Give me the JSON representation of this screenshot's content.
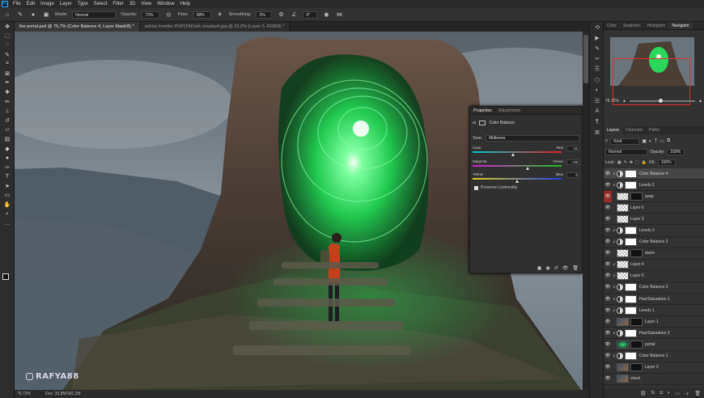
{
  "menu": [
    "File",
    "Edit",
    "Image",
    "Layer",
    "Type",
    "Select",
    "Filter",
    "3D",
    "View",
    "Window",
    "Help"
  ],
  "options": {
    "mode_label": "Mode:",
    "mode_value": "Normal",
    "opacity_label": "Opacity:",
    "opacity_value": "72%",
    "flow_label": "Flow:",
    "flow_value": "38%",
    "smoothing_label": "Smoothing:",
    "smoothing_value": "2%",
    "angle_value": "0°"
  },
  "tabs": [
    "the portal.psd @ 76,7% (Color Balance 4, Layer Mask/8) *",
    "ashley knedler PiSPjTADokk unsplash.jpg @ 22,2% (Layer 0, RGB/8) *"
  ],
  "status": {
    "zoom": "76,72%",
    "doc": "Doc: 15,8M/181,2M"
  },
  "watermark": "RAFYA88",
  "panel": {
    "tabs": [
      "Color",
      "Swatches",
      "Histogram",
      "Navigator"
    ],
    "zoom_value": "76,72%",
    "layers_tabs": [
      "Layers",
      "Channels",
      "Paths"
    ],
    "filter_value": "Kind",
    "blend_value": "Normal",
    "opacity_label": "Opacity:",
    "opacity_value": "100%",
    "lock_label": "Lock:",
    "fill_label": "Fill:",
    "fill_value": "100%"
  },
  "layers": [
    {
      "name": "Color Balance 4",
      "type": "adj",
      "sel": true,
      "clip": true
    },
    {
      "name": "Levels 2",
      "type": "adj",
      "clip": true
    },
    {
      "name": "asap",
      "type": "check",
      "mask": "dark",
      "eye_red": true
    },
    {
      "name": "Layer 6",
      "type": "check"
    },
    {
      "name": "Layer 3",
      "type": "check"
    },
    {
      "name": "Levels 3",
      "type": "adj",
      "clip": true
    },
    {
      "name": "Color Balance 2",
      "type": "adj",
      "clip": true
    },
    {
      "name": "stairs",
      "type": "check",
      "mask": "dark"
    },
    {
      "name": "Layer 4",
      "type": "check",
      "clip": true
    },
    {
      "name": "Layer 5",
      "type": "check",
      "clip": true
    },
    {
      "name": "Color Balance 3",
      "type": "adj",
      "clip": true
    },
    {
      "name": "Hue/Saturation 1",
      "type": "adj",
      "clip": true
    },
    {
      "name": "Levels 1",
      "type": "adj",
      "clip": true
    },
    {
      "name": "Layer 1",
      "type": "img",
      "mask": "dark"
    },
    {
      "name": "Hue/Saturation 2",
      "type": "adj",
      "clip": true
    },
    {
      "name": "portal",
      "type": "green",
      "mask": "dark"
    },
    {
      "name": "Color Balance 1",
      "type": "adj",
      "clip": true
    },
    {
      "name": "Layer 2",
      "type": "img",
      "mask": "dark"
    },
    {
      "name": "cloud",
      "type": "img"
    }
  ],
  "properties": {
    "tabs": [
      "Properties",
      "Adjustments"
    ],
    "title": "Color Balance",
    "tone_label": "Tone:",
    "tone_value": "Midtones",
    "sliders": [
      {
        "left": "Cyan",
        "right": "Red",
        "value": "-11",
        "pos": 0.45,
        "c1": "#00c8d0",
        "c2": "#e02020"
      },
      {
        "left": "Magenta",
        "right": "Green",
        "value": "+26",
        "pos": 0.62,
        "c1": "#d020d0",
        "c2": "#20c020"
      },
      {
        "left": "Yellow",
        "right": "Blue",
        "value": "0",
        "pos": 0.5,
        "c1": "#e0d020",
        "c2": "#2040e0"
      }
    ],
    "preserve_label": "Preserve Luminosity"
  }
}
